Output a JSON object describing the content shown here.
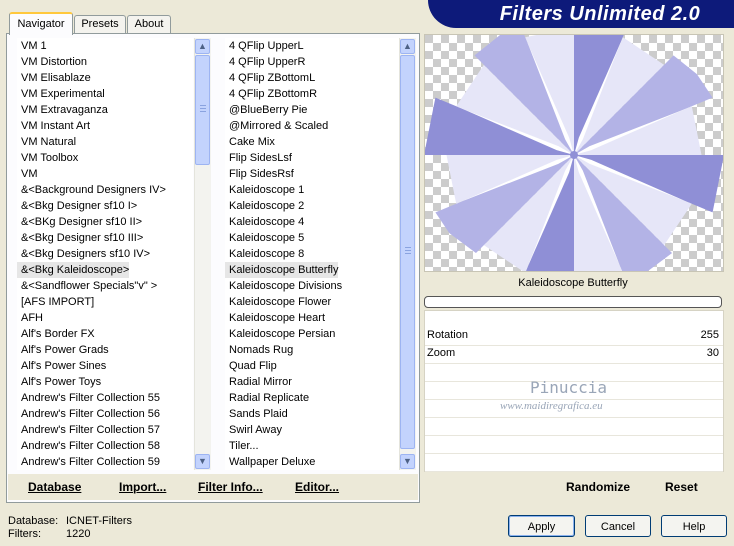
{
  "tabs": [
    {
      "label": "Navigator",
      "active": true
    },
    {
      "label": "Presets",
      "active": false
    },
    {
      "label": "About",
      "active": false
    }
  ],
  "title": "Filters Unlimited 2.0",
  "categories": [
    "VM 1",
    "VM Distortion",
    "VM Elisablaze",
    "VM Experimental",
    "VM Extravaganza",
    "VM Instant Art",
    "VM Natural",
    "VM Toolbox",
    "VM",
    "&<Background Designers IV>",
    "&<Bkg Designer sf10 I>",
    "&<BKg Designer sf10 II>",
    "&<Bkg Designer sf10 III>",
    "&<Bkg Designers sf10 IV>",
    "&<Bkg Kaleidoscope>",
    "&<Sandflower Specials\"v\" >",
    "[AFS IMPORT]",
    "AFH",
    "Alf's Border FX",
    "Alf's Power Grads",
    "Alf's Power Sines",
    "Alf's Power Toys",
    "Andrew's Filter Collection 55",
    "Andrew's Filter Collection 56",
    "Andrew's Filter Collection 57",
    "Andrew's Filter Collection 58",
    "Andrew's Filter Collection 59"
  ],
  "categories_selected": 14,
  "filters": [
    "4 QFlip UpperL",
    "4 QFlip UpperR",
    "4 QFlip ZBottomL",
    "4 QFlip ZBottomR",
    "@BlueBerry Pie",
    "@Mirrored & Scaled",
    "Cake Mix",
    "Flip SidesLsf",
    "Flip SidesRsf",
    "Kaleidoscope 1",
    "Kaleidoscope 2",
    "Kaleidoscope 4",
    "Kaleidoscope 5",
    "Kaleidoscope 8",
    "Kaleidoscope Butterfly",
    "Kaleidoscope Divisions",
    "Kaleidoscope Flower",
    "Kaleidoscope Heart",
    "Kaleidoscope Persian",
    "Nomads Rug",
    "Quad Flip",
    "Radial Mirror",
    "Radial Replicate",
    "Sands Plaid",
    "Swirl Away",
    "Tiler...",
    "Wallpaper Deluxe"
  ],
  "filters_selected": 14,
  "links": {
    "database": "Database",
    "import": "Import...",
    "filter_info": "Filter Info...",
    "editor": "Editor..."
  },
  "preview": {
    "filter_name": "Kaleidoscope Butterfly",
    "colors": {
      "light": "#e6e6f8",
      "mid": "#b3b3e6",
      "dark": "#8f8fd6",
      "checker": "#cccccc"
    }
  },
  "params": [
    {
      "label": "Rotation",
      "value": "255"
    },
    {
      "label": "Zoom",
      "value": "30"
    }
  ],
  "watermark": {
    "name": "Pinuccia",
    "site": "www.maidiregrafica.eu"
  },
  "right_links": {
    "randomize": "Randomize",
    "reset": "Reset"
  },
  "info": {
    "database_label": "Database:",
    "database_value": "ICNET-Filters",
    "filters_label": "Filters:",
    "filters_value": "1220"
  },
  "buttons": {
    "apply": "Apply",
    "cancel": "Cancel",
    "help": "Help"
  }
}
